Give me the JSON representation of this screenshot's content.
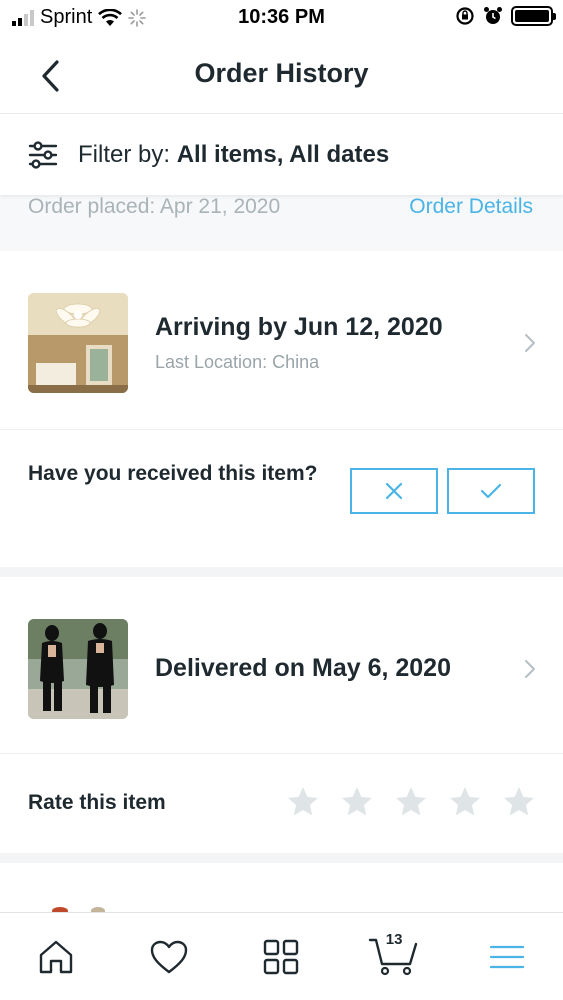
{
  "status_bar": {
    "carrier": "Sprint",
    "time": "10:36 PM"
  },
  "header": {
    "title": "Order History"
  },
  "filter": {
    "label": "Filter by:",
    "value": "All items, All dates"
  },
  "order": {
    "placed_text": "Order placed: Apr 21, 2020",
    "details_link": "Order Details"
  },
  "items": [
    {
      "title": "Arriving by Jun 12, 2020",
      "subtitle": "Last Location: China",
      "thumbnail": "ceiling-light-photo",
      "question": "Have you received this item?"
    },
    {
      "title": "Delivered on May 6, 2020",
      "thumbnail": "black-dress-photo",
      "rate_label": "Rate this item",
      "rating": 0,
      "max_rating": 5
    }
  ],
  "bottom_nav": {
    "items": [
      "home-icon",
      "heart-icon",
      "grid-icon",
      "cart-icon",
      "menu-icon"
    ],
    "cart_count": "13"
  },
  "colors": {
    "accent": "#4ab4e6",
    "text": "#1f2a30",
    "muted": "#9aa4a9",
    "star_empty": "#dfe4e7"
  }
}
